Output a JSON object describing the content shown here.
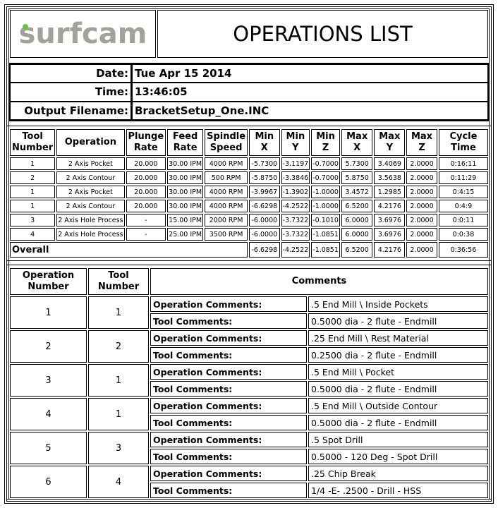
{
  "header": {
    "logo_text": "surfcam",
    "title": "OPERATIONS LIST"
  },
  "info": {
    "date_label": "Date:",
    "date_value": "Tue Apr 15 2014",
    "time_label": "Time:",
    "time_value": "13:46:05",
    "filename_label": "Output Filename:",
    "filename_value": "BracketSetup_One.INC"
  },
  "operations": {
    "columns": [
      "Tool Number",
      "Operation",
      "Plunge Rate",
      "Feed Rate",
      "Spindle Speed",
      "Min X",
      "Min Y",
      "Min Z",
      "Max X",
      "Max Y",
      "Max Z",
      "Cycle Time"
    ],
    "column_lines": [
      [
        "Tool",
        "Number"
      ],
      [
        "Operation"
      ],
      [
        "Plunge",
        "Rate"
      ],
      [
        "Feed",
        "Rate"
      ],
      [
        "Spindle",
        "Speed"
      ],
      [
        "Min X"
      ],
      [
        "Min Y"
      ],
      [
        "Min Z"
      ],
      [
        "Max X"
      ],
      [
        "Max Y"
      ],
      [
        "Max Z"
      ],
      [
        "Cycle Time"
      ]
    ],
    "rows": [
      [
        "1",
        "2 Axis Pocket",
        "20.000",
        "30.00 IPM",
        "4000 RPM",
        "-5.7300",
        "-3.1197",
        "-0.7000",
        "5.7300",
        "3.4069",
        "2.0000",
        "0:16:11"
      ],
      [
        "2",
        "2 Axis Contour",
        "20.000",
        "30.00 IPM",
        "500 RPM",
        "-5.8750",
        "-3.3846",
        "-0.7000",
        "5.8750",
        "3.5638",
        "2.0000",
        "0:11:29"
      ],
      [
        "1",
        "2 Axis Pocket",
        "20.000",
        "30.00 IPM",
        "4000 RPM",
        "-3.9967",
        "-1.3902",
        "-1.0000",
        "3.4572",
        "1.2985",
        "2.0000",
        "0:4:15"
      ],
      [
        "1",
        "2 Axis Contour",
        "20.000",
        "30.00 IPM",
        "4000 RPM",
        "-6.6298",
        "-4.2522",
        "-1.0000",
        "6.5200",
        "4.2176",
        "2.0000",
        "0:4:9"
      ],
      [
        "3",
        "2 Axis Hole Process",
        "-",
        "15.00 IPM",
        "2000 RPM",
        "-6.0000",
        "-3.7322",
        "-0.1010",
        "6.0000",
        "3.6976",
        "2.0000",
        "0:0:11"
      ],
      [
        "4",
        "2 Axis Hole Process",
        "-",
        "25.00 IPM",
        "3500 RPM",
        "-6.0000",
        "-3.7322",
        "-1.0851",
        "6.0000",
        "3.6976",
        "2.0000",
        "0:0:38"
      ]
    ],
    "overall": {
      "label": "Overall",
      "values": [
        "-6.6298",
        "-4.2522",
        "-1.0851",
        "6.5200",
        "4.2176",
        "2.0000",
        "0:36:56"
      ]
    }
  },
  "comments": {
    "col_op_number": [
      "Operation",
      "Number"
    ],
    "col_tool_number": [
      "Tool",
      "Number"
    ],
    "col_comments": "Comments",
    "op_label": "Operation Comments:",
    "tool_label": "Tool Comments:",
    "rows": [
      {
        "op": "1",
        "tool": "1",
        "op_comment": ".5 End Mill \\ Inside Pockets",
        "tool_comment": "0.5000 dia - 2 flute - Endmill"
      },
      {
        "op": "2",
        "tool": "2",
        "op_comment": ".25 End Mill \\ Rest Material",
        "tool_comment": "0.2500 dia - 2 flute - Endmill"
      },
      {
        "op": "3",
        "tool": "1",
        "op_comment": ".5 End Mill \\ Pocket",
        "tool_comment": "0.5000 dia - 2 flute - Endmill"
      },
      {
        "op": "4",
        "tool": "1",
        "op_comment": ".5 End Mill \\ Outside Contour",
        "tool_comment": "0.5000 dia - 2 flute - Endmill"
      },
      {
        "op": "5",
        "tool": "3",
        "op_comment": ".5 Spot Drill",
        "tool_comment": "0.5000 - 120 Deg - Spot Drill"
      },
      {
        "op": "6",
        "tool": "4",
        "op_comment": ".25 Chip Break",
        "tool_comment": "1/4 -E- .2500 - Drill - HSS"
      }
    ]
  },
  "colors": {
    "logo_text": "#a3a199",
    "logo_dot": "#6cc04a"
  }
}
